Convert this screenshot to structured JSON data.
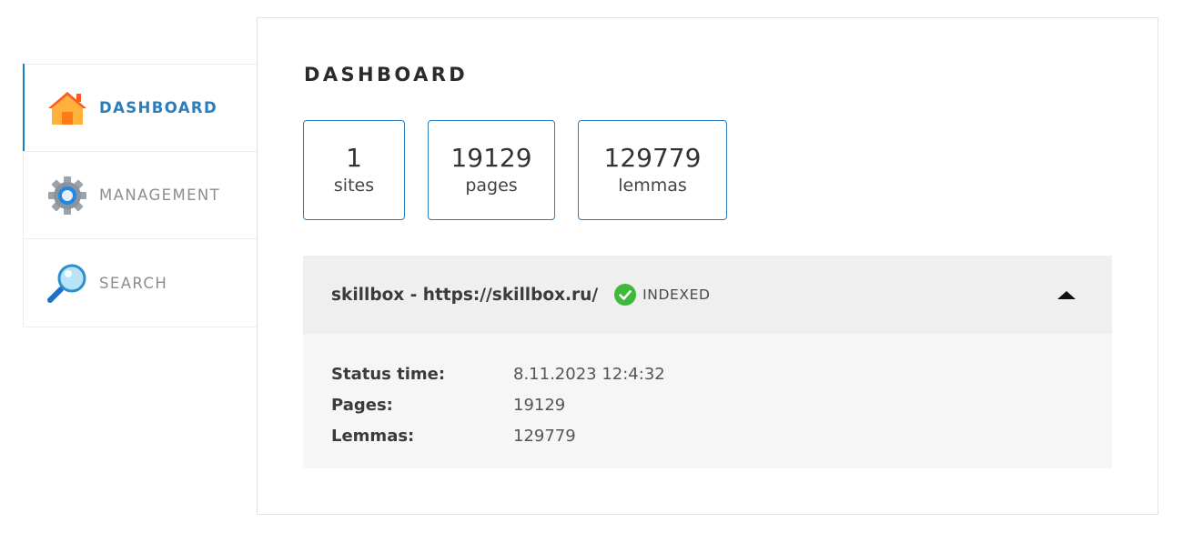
{
  "sidebar": {
    "items": [
      {
        "label": "DASHBOARD",
        "icon": "home-icon",
        "active": true
      },
      {
        "label": "MANAGEMENT",
        "icon": "gear-icon",
        "active": false
      },
      {
        "label": "SEARCH",
        "icon": "magnifier-icon",
        "active": false
      }
    ]
  },
  "main": {
    "title": "DASHBOARD",
    "stats": [
      {
        "value": "1",
        "label": "sites"
      },
      {
        "value": "19129",
        "label": "pages"
      },
      {
        "value": "129779",
        "label": "lemmas"
      }
    ],
    "site": {
      "name": "skillbox - https://skillbox.ru/",
      "status": "INDEXED",
      "status_color": "#3fb93a",
      "expanded": true,
      "details": [
        {
          "key": "Status time:",
          "value": "8.11.2023 12:4:32"
        },
        {
          "key": "Pages:",
          "value": "19129"
        },
        {
          "key": "Lemmas:",
          "value": "129779"
        }
      ]
    }
  },
  "colors": {
    "accent": "#2b7dbc",
    "border": "#eeeeee",
    "header_bg": "#efefef",
    "body_bg": "#f6f6f6"
  }
}
